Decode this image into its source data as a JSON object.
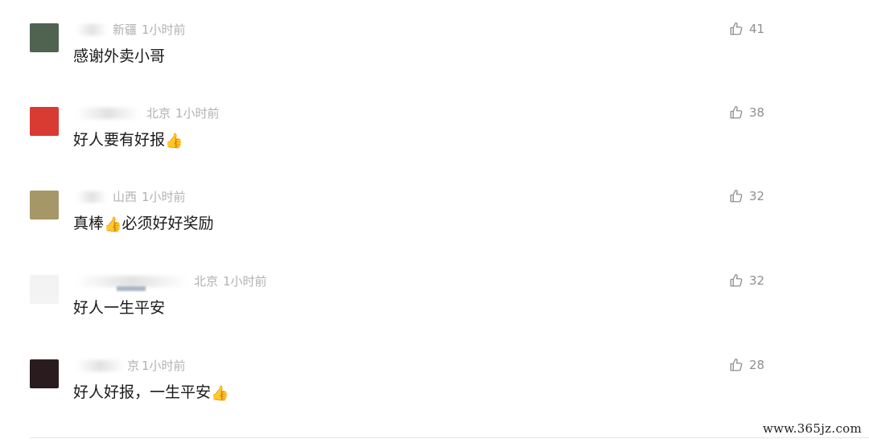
{
  "comments": [
    {
      "location": "新疆",
      "time": "1小时前",
      "text": "感谢外卖小哥",
      "emoji": "",
      "likes": "41",
      "avatar_color": "#4f6350"
    },
    {
      "location": "北京",
      "time": "1小时前",
      "text": "好人要有好报",
      "emoji": "👍",
      "likes": "38",
      "avatar_color": "#d83b32"
    },
    {
      "location": "山西",
      "time": "1小时前",
      "text": "真棒",
      "emoji": "👍",
      "text_after": "必须好好奖励",
      "likes": "32",
      "avatar_color": "#a69768"
    },
    {
      "location": "北京",
      "time": "1小时前",
      "text": "好人一生平安",
      "emoji": "",
      "likes": "32",
      "avatar_color": "#f3f3f3"
    },
    {
      "location": "京",
      "time": "1小时前",
      "text": "好人好报，一生平安",
      "emoji": "👍",
      "likes": "28",
      "avatar_color": "#2a1c1e"
    }
  ],
  "icons": {
    "like": "thumbs-up-outline-icon"
  },
  "watermark": "www.365jz.com"
}
